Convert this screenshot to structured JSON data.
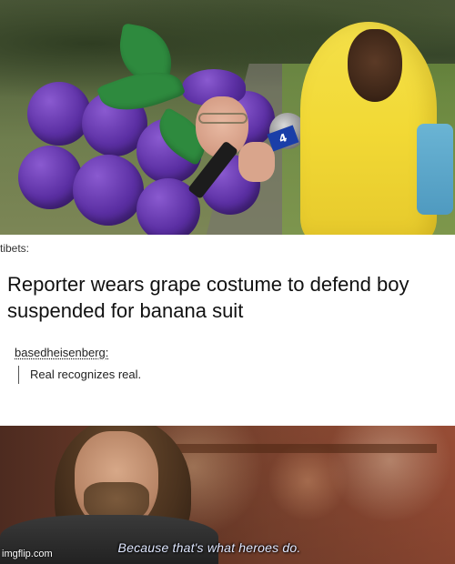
{
  "post": {
    "username": "tibets:",
    "headline": "Reporter wears grape costume to defend boy suspended for banana suit",
    "reblog_user": "basedheisenberg:",
    "reblog_comment": "Real recognizes real."
  },
  "photo_top": {
    "mic_flag_text": "4"
  },
  "photo_bottom": {
    "caption": "Because that's what heroes do.",
    "watermark": "imgflip.com"
  },
  "colors": {
    "grape": "#5b2fa3",
    "leaf": "#2e8a3e",
    "banana": "#f2d935",
    "caption_text": "#dfe7ff"
  }
}
